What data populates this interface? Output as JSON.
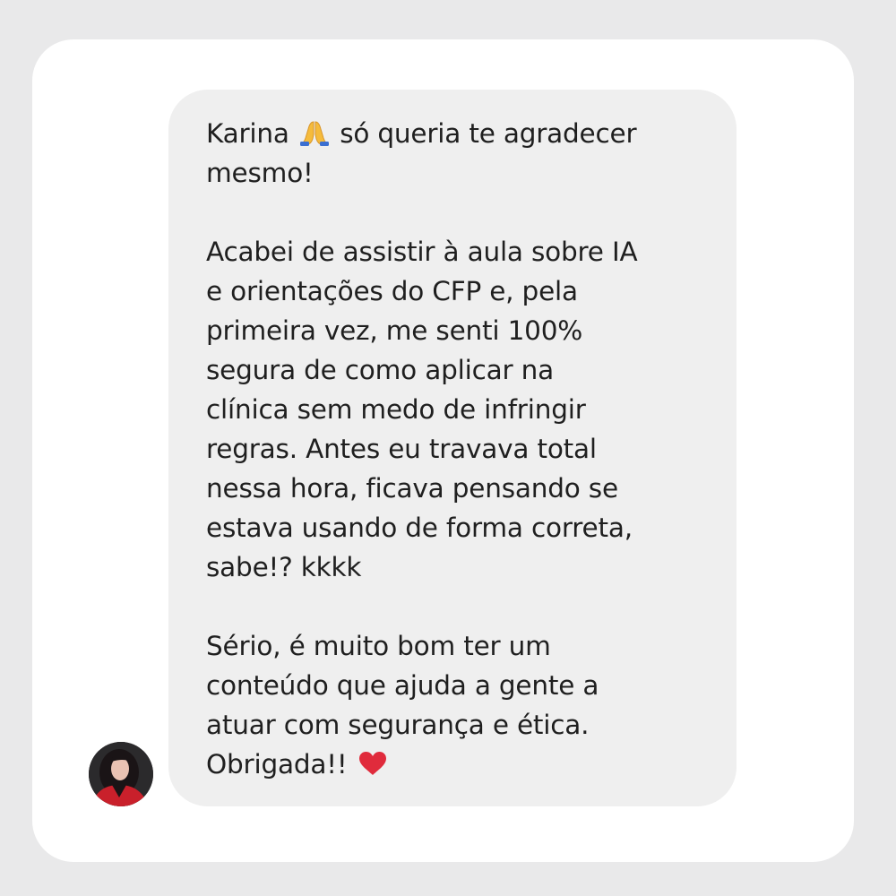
{
  "message": {
    "paragraphs": [
      {
        "lines": [
          {
            "before": "Karina",
            "icon": "folded-hands-emoji",
            "after": "só queria te agradecer"
          },
          {
            "text": "mesmo!"
          }
        ]
      },
      {
        "lines": [
          {
            "text": "Acabei de assistir à aula sobre IA"
          },
          {
            "text": "e orientações do CFP e, pela"
          },
          {
            "text": "primeira vez, me senti 100%"
          },
          {
            "text": "segura de como aplicar na"
          },
          {
            "text": "clínica sem medo de infringir"
          },
          {
            "text": "regras. Antes eu travava total"
          },
          {
            "text": "nessa hora, ficava pensando se"
          },
          {
            "text": "estava usando de forma correta,"
          },
          {
            "text": "sabe!? kkkk"
          }
        ]
      },
      {
        "lines": [
          {
            "text": "Sério, é muito bom ter um"
          },
          {
            "text": "conteúdo que ajuda a gente a"
          },
          {
            "text": "atuar com segurança e ética."
          },
          {
            "before": "Obrigada!!",
            "icon": "red-heart-emoji"
          }
        ]
      }
    ]
  },
  "colors": {
    "page_background": "#e9e9ea",
    "card": "#ffffff",
    "bubble": "#efefef",
    "text": "#1f1f1f",
    "heart": "#e02b3c"
  },
  "avatar": {
    "icon": "profile-photo-avatar"
  }
}
